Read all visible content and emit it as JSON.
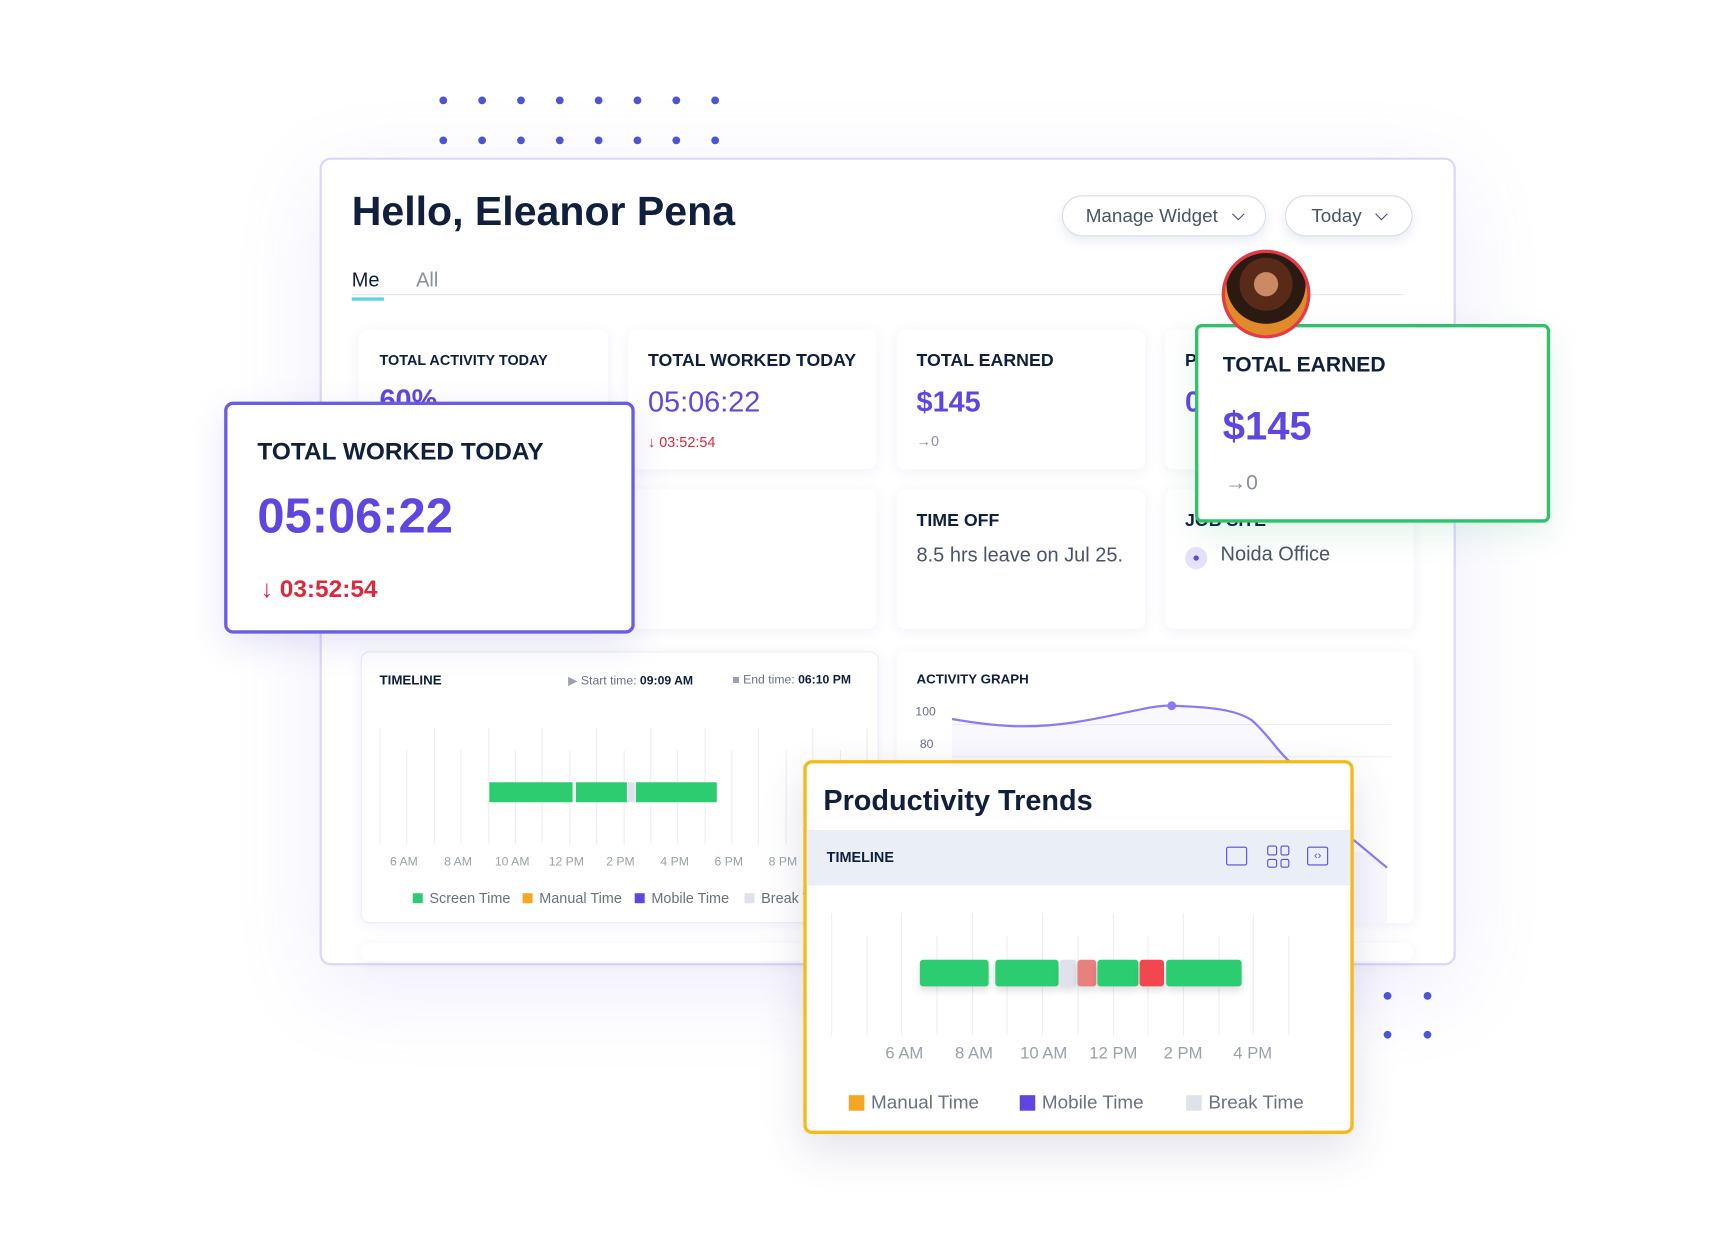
{
  "header": {
    "greeting": "Hello, Eleanor Pena",
    "manage_widget": "Manage Widget",
    "range": "Today"
  },
  "tabs": [
    {
      "label": "Me",
      "active": true
    },
    {
      "label": "All",
      "active": false
    }
  ],
  "cards": {
    "activity": {
      "title": "TOTAL ACTIVITY TODAY",
      "value": "60%"
    },
    "worked": {
      "title": "TOTAL WORKED TODAY",
      "value": "05:06:22",
      "delta": "03:52:54",
      "delta_dir": "down"
    },
    "earned": {
      "title": "TOTAL EARNED",
      "value": "$145",
      "delta": "0"
    },
    "partial": {
      "title": "P",
      "value": "0"
    },
    "timeoff": {
      "title": "TIME OFF",
      "text": "8.5 hrs leave on Jul 25."
    },
    "jobsite": {
      "title": "JOB SITE",
      "location": "Noida Office"
    }
  },
  "timeline": {
    "title": "TIMELINE",
    "start_label": "Start time:",
    "start": "09:09 AM",
    "end_label": "End time:",
    "end": "06:10 PM",
    "ticks": [
      "6 AM",
      "8 AM",
      "10 AM",
      "12 PM",
      "2 PM",
      "4 PM",
      "6 PM",
      "8 PM"
    ],
    "legend": [
      "Screen Time",
      "Manual Time",
      "Mobile Time",
      "Break T"
    ],
    "segments": [
      {
        "type": "screen",
        "from": 9.15,
        "to": 12.27
      },
      {
        "type": "screen",
        "from": 12.35,
        "to": 14.28
      },
      {
        "type": "break",
        "from": 14.28,
        "to": 14.57
      },
      {
        "type": "screen",
        "from": 14.57,
        "to": 17.6
      }
    ]
  },
  "activity_graph": {
    "title": "ACTIVITY GRAPH",
    "yticks": [
      "100",
      "80"
    ]
  },
  "float_worked": {
    "title": "TOTAL WORKED TODAY",
    "value": "05:06:22",
    "delta": "03:52:54"
  },
  "float_earned": {
    "title": "TOTAL EARNED",
    "value": "$145",
    "delta": "0"
  },
  "productivity": {
    "title": "Productivity Trends",
    "section": "TIMELINE",
    "ticks": [
      "6 AM",
      "8 AM",
      "10 AM",
      "12 PM",
      "2 PM",
      "4 PM"
    ],
    "legend": [
      "Manual Time",
      "Mobile Time",
      "Break Time"
    ],
    "segments": [
      {
        "type": "screen",
        "from": 6.45,
        "to": 8.45
      },
      {
        "type": "screen",
        "from": 8.6,
        "to": 10.46
      },
      {
        "type": "break",
        "from": 10.46,
        "to": 10.97
      },
      {
        "type": "idle",
        "from": 10.97,
        "to": 11.54
      },
      {
        "type": "screen",
        "from": 11.54,
        "to": 12.75
      },
      {
        "type": "alert",
        "from": 12.75,
        "to": 13.5
      },
      {
        "type": "screen",
        "from": 13.5,
        "to": 15.7
      }
    ]
  },
  "colors": {
    "accent": "#6046e0",
    "screen": "#2ecc71",
    "manual": "#f5a623",
    "mobile": "#6046e0",
    "break": "#dfe2ea",
    "idle": "#e88080",
    "alert": "#f2474f",
    "green_border": "#2ec26b",
    "yellow_border": "#f5b918"
  }
}
